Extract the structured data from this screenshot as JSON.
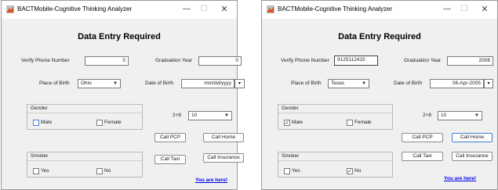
{
  "windows": [
    {
      "title": "BACTMobile-Cognitive Thinking Analyzer",
      "heading": "Data Entry Required",
      "phone_label": "Verify Phone Number",
      "phone_value": "0",
      "grad_label": "Graduation Year",
      "grad_value": "0",
      "birth_label": "Place of Birth",
      "birth_value": "Ohio",
      "date_label": "Date of Birth",
      "date_value": "mm/dd/yyyy",
      "gender_title": "Gender",
      "male_label": "Male",
      "female_label": "Female",
      "male_check": "",
      "female_check": "",
      "math_label": "2+8",
      "math_value": "10",
      "btn_pcp": "Call PCP",
      "btn_home": "Call Home",
      "smoker_title": "Smoker",
      "yes_label": "Yes",
      "no_label": "No",
      "yes_check": "",
      "no_check": "",
      "btn_taxi": "Call Taxi",
      "btn_insurance": "Call Insurance",
      "link": "You are here!"
    },
    {
      "title": "BACTMobile-Cognitive Thinking Analyzer",
      "heading": "Data Entry Required",
      "phone_label": "Verify Phone Number",
      "phone_value": "9125112415",
      "grad_label": "Graduation Year",
      "grad_value": "2008",
      "birth_label": "Place of Birth",
      "birth_value": "Texas",
      "date_label": "Date of Birth",
      "date_value": "06-Apr-2005",
      "gender_title": "Gender",
      "male_label": "Male",
      "female_label": "Female",
      "male_check": "✓",
      "female_check": "",
      "math_label": "2+8",
      "math_value": "10",
      "btn_pcp": "Call PCP",
      "btn_home": "Call Home",
      "smoker_title": "Smoker",
      "yes_label": "Yes",
      "no_label": "No",
      "yes_check": "",
      "no_check": "✓",
      "btn_taxi": "Call Taxi",
      "btn_insurance": "Call Insurance",
      "link": "You are here!"
    }
  ]
}
